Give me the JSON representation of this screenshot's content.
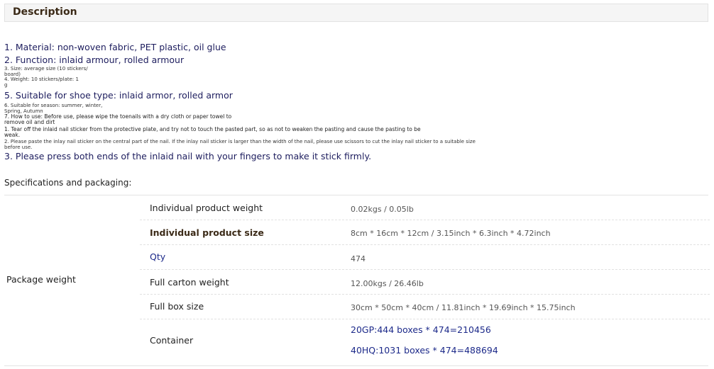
{
  "description": {
    "header": "Description",
    "lines": [
      "1. Material: non-woven fabric, PET plastic, oil glue",
      "2. Function: inlaid armour, rolled armour",
      "3. Size: average size (10 stickers/",
      "board)",
      "4. Weight: 10 stickers/plate: 1",
      "g",
      "5. Suitable for shoe type: inlaid armor, rolled armor",
      "6. Suitable for season: summer, winter,",
      "Spring, Autumn",
      "7. How to use: Before use, please wipe the toenails with a dry cloth or paper towel to",
      "remove oil and dirt",
      "1. Tear off the inlaid nail sticker from the protective plate, and try not to touch the pasted part, so as not to weaken the pasting and cause the pasting to be",
      "weak.",
      "2. Please paste the inlay nail sticker on the central part of the nail. If the inlay nail sticker is larger than the width of the nail, please use scissors to cut the inlay nail sticker to a suitable size",
      "before use.",
      "3. Please press both ends of the inlaid nail with your fingers to make it stick firmly."
    ]
  },
  "specs": {
    "title": "Specifications and packaging:",
    "group_label": "Package weight",
    "rows": [
      {
        "label": "Individual product weight",
        "value": "0.02kgs / 0.05lb"
      },
      {
        "label": "Individual product size",
        "value": "8cm * 16cm * 12cm / 3.15inch * 6.3inch * 4.72inch"
      },
      {
        "label": "Qty",
        "value": "474"
      },
      {
        "label": "Full carton weight",
        "value": "12.00kgs / 26.46lb"
      },
      {
        "label": "Full box size",
        "value": "30cm * 50cm * 40cm / 11.81inch * 19.69inch * 15.75inch"
      },
      {
        "label": "Container",
        "value": "20GP:444 boxes * 474=210456",
        "value2": "40HQ:1031 boxes * 474=488694"
      }
    ]
  }
}
